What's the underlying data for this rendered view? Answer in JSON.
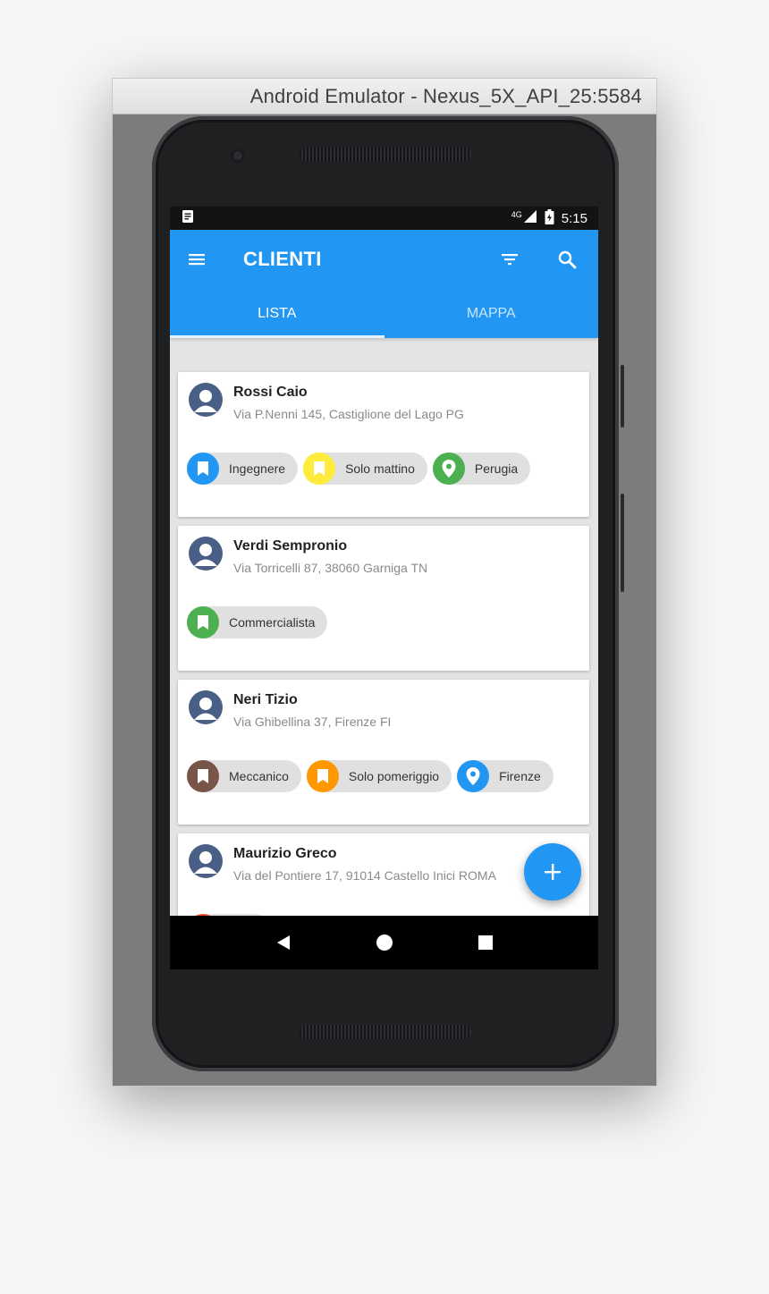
{
  "window": {
    "title": "Android Emulator - Nexus_5X_API_25:5584"
  },
  "statusbar": {
    "network": "4G",
    "time": "5:15"
  },
  "appbar": {
    "title": "CLIENTI",
    "menu_icon": "menu-icon",
    "filter_icon": "filter-icon",
    "search_icon": "search-icon"
  },
  "tabs": [
    {
      "label": "LISTA",
      "active": true
    },
    {
      "label": "MAPPA",
      "active": false
    }
  ],
  "clients": [
    {
      "name": "Rossi Caio",
      "address": "Via P.Nenni 145, Castiglione del Lago PG",
      "chips": [
        {
          "label": "Ingegnere",
          "icon": "bookmark-icon",
          "color": "#2196f3"
        },
        {
          "label": "Solo mattino",
          "icon": "bookmark-icon",
          "color": "#ffeb3b"
        },
        {
          "label": "Perugia",
          "icon": "map-pin-icon",
          "color": "#4caf50"
        }
      ]
    },
    {
      "name": "Verdi Sempronio",
      "address": "Via Torricelli 87, 38060 Garniga TN",
      "chips": [
        {
          "label": "Commercialista",
          "icon": "bookmark-icon",
          "color": "#4caf50"
        }
      ]
    },
    {
      "name": "Neri Tizio",
      "address": "Via Ghibellina 37, Firenze FI",
      "chips": [
        {
          "label": "Meccanico",
          "icon": "bookmark-icon",
          "color": "#795548"
        },
        {
          "label": "Solo pomeriggio",
          "icon": "bookmark-icon",
          "color": "#ff9800"
        },
        {
          "label": "Firenze",
          "icon": "map-pin-icon",
          "color": "#2196f3"
        }
      ]
    },
    {
      "name": "Maurizio Greco",
      "address": "Via del Pontiere 17, 91014 Castello Inici ROMA",
      "chips": [
        {
          "label": "",
          "icon": "bookmark-icon",
          "color": "#f44336"
        }
      ]
    }
  ],
  "fab": {
    "icon": "plus-icon"
  },
  "navbar": {
    "back_icon": "back-icon",
    "home_icon": "home-icon",
    "recents_icon": "recents-icon"
  }
}
